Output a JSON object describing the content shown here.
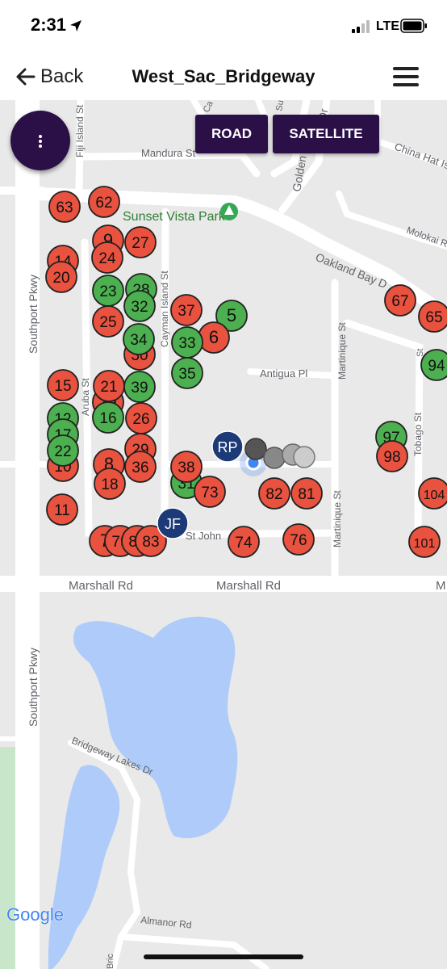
{
  "status_bar": {
    "time": "2:31",
    "network": "LTE",
    "icons": [
      "location-arrow-icon",
      "signal-bars-icon",
      "battery-icon"
    ]
  },
  "nav": {
    "back_label": "Back",
    "title": "West_Sac_Bridgeway",
    "icons": [
      "back-arrow-icon",
      "hamburger-menu-icon"
    ]
  },
  "map_type": {
    "road": "ROAD",
    "satellite": "SATELLITE"
  },
  "colors": {
    "header_bg": "#ffffff",
    "button_bg": "#2b0f47",
    "marker_red": "#e8523f",
    "marker_green": "#4caf50",
    "user_marker": "#1d3a78",
    "water": "#aecbfa",
    "park": "#c8e6c9"
  },
  "map_labels": {
    "fiji_island": "Fiji Island St",
    "mandura": "Mandura St",
    "sunset_vista": "Sunset Vista Park",
    "oakland_bay": "Oakland Bay D",
    "china_hat": "China Hat Is",
    "molokai": "Molokai Rd",
    "southport_top": "Southport Pkwy",
    "southport_bottom": "Southport Pkwy",
    "cayman_island": "Cayman Island St",
    "aruba": "Aruba St",
    "antigua": "Antigua Pl",
    "martinique_top": "Martinique St",
    "martinique_bottom": "Martinique St",
    "tobago": "Tobago St",
    "st_john": "St John",
    "marshall_left": "Marshall Rd",
    "marshall_center": "Marshall Rd",
    "marshall_right": "M",
    "golden": "Golden",
    "bridgeway_lakes": "Bridgeway Lakes Dr",
    "almanor": "Almanor Rd",
    "bric": "Bric",
    "google": "Google",
    "su": "Su",
    "ca": "Ca",
    "dr": "Dr",
    "st_frag": "St"
  },
  "markers": [
    {
      "label": "63",
      "color": "red"
    },
    {
      "label": "62",
      "color": "red"
    },
    {
      "label": "9",
      "color": "red"
    },
    {
      "label": "27",
      "color": "red"
    },
    {
      "label": "14",
      "color": "red"
    },
    {
      "label": "20",
      "color": "red"
    },
    {
      "label": "24",
      "color": "red"
    },
    {
      "label": "28",
      "color": "green"
    },
    {
      "label": "23",
      "color": "green"
    },
    {
      "label": "32",
      "color": "green"
    },
    {
      "label": "25",
      "color": "red"
    },
    {
      "label": "37",
      "color": "red"
    },
    {
      "label": "5",
      "color": "green"
    },
    {
      "label": "30",
      "color": "red"
    },
    {
      "label": "34",
      "color": "green"
    },
    {
      "label": "6",
      "color": "red"
    },
    {
      "label": "33",
      "color": "green"
    },
    {
      "label": "35",
      "color": "green"
    },
    {
      "label": "15",
      "color": "red"
    },
    {
      "label": "19",
      "color": "red"
    },
    {
      "label": "21",
      "color": "red"
    },
    {
      "label": "39",
      "color": "green"
    },
    {
      "label": "16",
      "color": "green"
    },
    {
      "label": "26",
      "color": "red"
    },
    {
      "label": "12",
      "color": "green"
    },
    {
      "label": "17",
      "color": "green"
    },
    {
      "label": "29",
      "color": "red"
    },
    {
      "label": "10",
      "color": "red"
    },
    {
      "label": "22",
      "color": "green"
    },
    {
      "label": "8",
      "color": "red"
    },
    {
      "label": "36",
      "color": "red"
    },
    {
      "label": "18",
      "color": "red"
    },
    {
      "label": "31",
      "color": "green"
    },
    {
      "label": "38",
      "color": "red"
    },
    {
      "label": "73",
      "color": "red"
    },
    {
      "label": "11",
      "color": "red"
    },
    {
      "label": "82",
      "color": "red"
    },
    {
      "label": "81",
      "color": "red"
    },
    {
      "label": "7",
      "color": "red"
    },
    {
      "label": "79",
      "color": "red"
    },
    {
      "label": "80",
      "color": "red"
    },
    {
      "label": "83",
      "color": "red"
    },
    {
      "label": "74",
      "color": "red"
    },
    {
      "label": "76",
      "color": "red"
    },
    {
      "label": "67",
      "color": "red"
    },
    {
      "label": "65",
      "color": "red"
    },
    {
      "label": "94",
      "color": "green"
    },
    {
      "label": "97",
      "color": "green"
    },
    {
      "label": "98",
      "color": "red"
    },
    {
      "label": "104",
      "color": "red"
    },
    {
      "label": "101",
      "color": "red"
    }
  ],
  "user_markers": [
    {
      "label": "RP"
    },
    {
      "label": "JF"
    }
  ]
}
